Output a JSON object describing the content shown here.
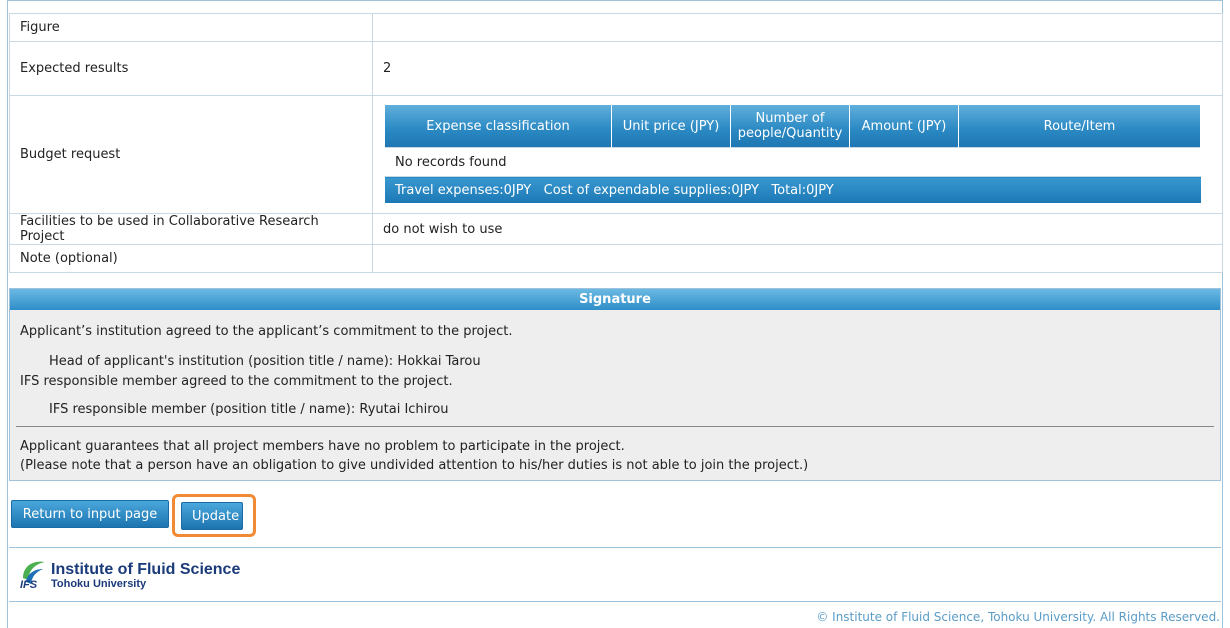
{
  "form": {
    "rows": [
      {
        "label": "Figure",
        "value": ""
      },
      {
        "label": "Expected results",
        "value": "2"
      }
    ],
    "budget": {
      "label": "Budget request",
      "columns": [
        "Expense classification",
        "Unit price (JPY)",
        "Number of people/Quantity",
        "Amount (JPY)",
        "Route/Item"
      ],
      "empty_text": "No records found",
      "totals_text": "Travel expenses:0JPY   Cost of expendable supplies:0JPY   Total:0JPY"
    },
    "facilities": {
      "label": "Facilities to be used in Collaborative Research Project",
      "value": "do not wish to use"
    },
    "note": {
      "label": "Note (optional)",
      "value": ""
    }
  },
  "signature": {
    "header": "Signature",
    "agree_institution": "Applicant’s institution agreed to the applicant’s commitment to the project.",
    "head_label": "Head of applicant's institution (position title / name):",
    "head_value": "Hokkai Tarou",
    "agree_ifs": "IFS responsible member agreed to the commitment to the project.",
    "ifs_label": "IFS responsible member (position title / name):",
    "ifs_value": "Ryutai Ichirou",
    "guarantee": "Applicant guarantees that all project members have no problem to participate in the project.",
    "note": "(Please note that a person have an obligation to give undivided attention to his/her duties is not able to join the project.)"
  },
  "buttons": {
    "return_label": "Return to input page",
    "update_label": "Update"
  },
  "footer": {
    "logo_mark": "IFS",
    "logo_title": "Institute of Fluid Science",
    "logo_sub": "Tohoku University",
    "copyright": "© Institute of Fluid Science, Tohoku University. All Rights Reserved."
  },
  "colors": {
    "accent": "#2a88c2",
    "highlight": "#f08a35"
  }
}
